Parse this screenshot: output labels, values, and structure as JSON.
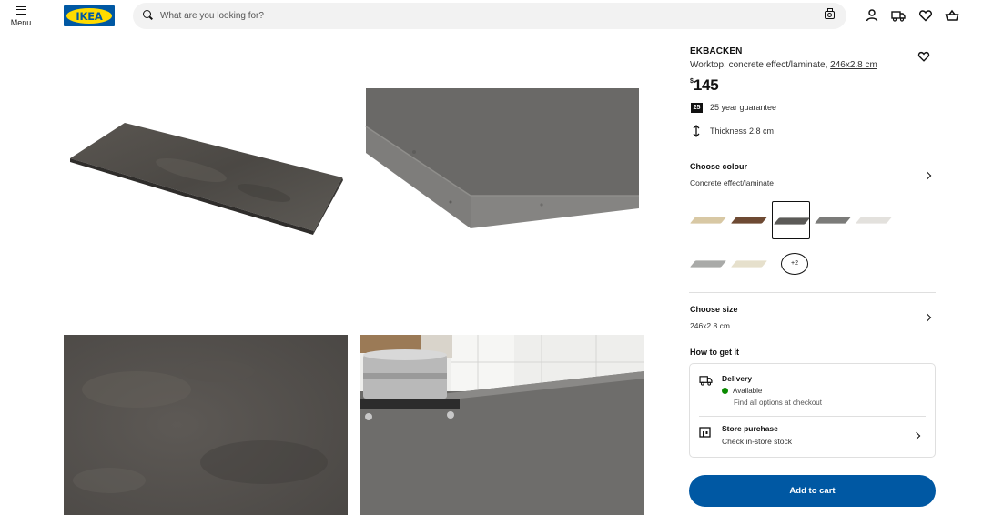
{
  "header": {
    "menu_label": "Menu",
    "logo_text": "IKEA",
    "search_placeholder": "What are you looking for?",
    "icons": [
      "menu-icon",
      "search-icon",
      "camera-icon",
      "profile-icon",
      "truck-icon",
      "heart-icon",
      "basket-icon"
    ]
  },
  "product": {
    "name": "EKBACKEN",
    "description": "Worktop, concrete effect/laminate,",
    "size_link": "246x2.8 cm",
    "price_currency": "$",
    "price_amount": "145",
    "guarantee_badge": "25",
    "guarantee_text": "25 year guarantee",
    "thickness_text": "Thickness 2.8 cm"
  },
  "colour": {
    "title": "Choose colour",
    "selected": "Concrete effect/laminate",
    "swatches": [
      {
        "name": "light-oak",
        "color": "#d8c8a4"
      },
      {
        "name": "walnut",
        "color": "#6e4a33"
      },
      {
        "name": "concrete-effect",
        "color": "#5b5a57",
        "selected": true
      },
      {
        "name": "dark-grey",
        "color": "#7b7b79"
      },
      {
        "name": "light-grey",
        "color": "#e3e1dd"
      },
      {
        "name": "grey-stone",
        "color": "#a9aaa8"
      },
      {
        "name": "beige",
        "color": "#e6e0cc"
      }
    ],
    "more_label": "+2"
  },
  "size": {
    "title": "Choose size",
    "selected": "246x2.8 cm"
  },
  "get_it": {
    "title": "How to get it",
    "delivery_title": "Delivery",
    "delivery_status": "Available",
    "delivery_note": "Find all options at checkout",
    "store_title": "Store purchase",
    "store_sub": "Check in-store stock",
    "status_color": "#0a8a00"
  },
  "cart": {
    "label": "Add to cart",
    "color": "#0058a3"
  },
  "gallery": [
    "worktop-full",
    "worktop-edge-closeup",
    "worktop-surface-texture",
    "worktop-kitchen-scene"
  ]
}
